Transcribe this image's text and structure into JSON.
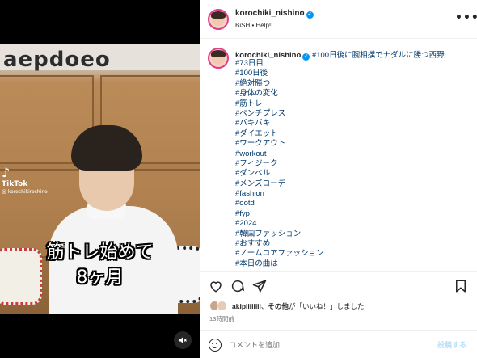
{
  "video": {
    "wall_text": "aepdoeo",
    "tiktok_logo": "TikTok",
    "tiktok_handle": "@ korochikiroshino",
    "caption_line1": "筋トレ始めて",
    "caption_line2": "8ヶ月",
    "mute_icon": "speaker-muted-icon"
  },
  "header": {
    "username": "korochiki_nishino",
    "subtitle": "BiSH • Help!!",
    "more_icon": "•••"
  },
  "post": {
    "username": "korochiki_nishino",
    "first_line": "#100日後に腕相撲でナダルに勝つ西野",
    "hashtags": [
      "#73日目",
      "#100日後",
      "#絶対勝つ",
      "#身体の変化",
      "#筋トレ",
      "#ベンチプレス",
      "#バキバキ",
      "#ダイエット",
      "#ワークアウト",
      "#workout",
      "#フィジーク",
      "#ダンベル",
      "#メンズコーデ",
      "#fashion",
      "#ootd",
      "#fyp",
      "#2024",
      "#韓国ファッション",
      "#おすすめ",
      "#ノームコアファッション",
      "#本日の曲は"
    ]
  },
  "likes": {
    "user": "akipiiiiiiii",
    "text_suffix": "、その他が「いいね！」しました",
    "others": "その他"
  },
  "time": "13時間前",
  "comment": {
    "placeholder": "コメントを追加...",
    "post_label": "投稿する"
  },
  "colors": {
    "link": "#00376b",
    "verified": "#0095f6",
    "story_ring": "#e23d8b"
  }
}
